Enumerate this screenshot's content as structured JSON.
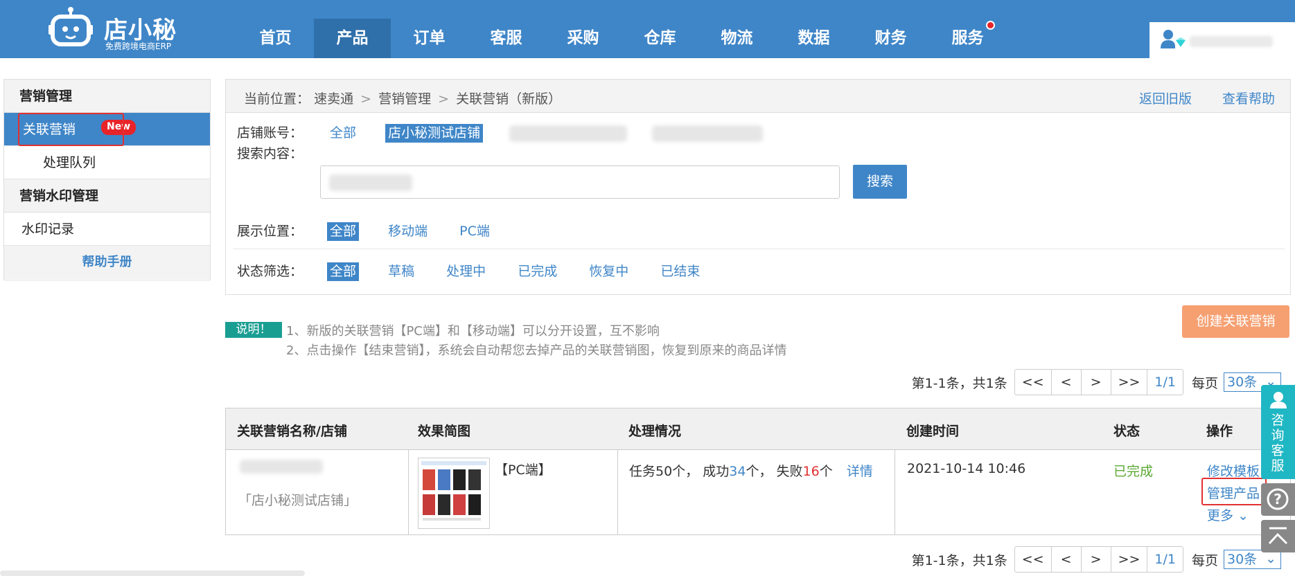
{
  "header": {
    "logo_brand": "店小秘",
    "logo_slogan": "免费跨境电商ERP",
    "nav": [
      {
        "label": "首页"
      },
      {
        "label": "产品",
        "active": true
      },
      {
        "label": "订单"
      },
      {
        "label": "客服"
      },
      {
        "label": "采购"
      },
      {
        "label": "仓库"
      },
      {
        "label": "物流"
      },
      {
        "label": "数据"
      },
      {
        "label": "财务"
      },
      {
        "label": "服务",
        "dot": true
      }
    ],
    "user_icon": "user-diamond-icon",
    "brand_color": "#3f86c8"
  },
  "sidebar": {
    "section1": "营销管理",
    "item_active": "关联营销",
    "new_badge": "New",
    "item_sub": "处理队列",
    "section2": "营销水印管理",
    "item_watermark": "水印记录",
    "help": "帮助手册"
  },
  "breadcrumb": {
    "prefix": "当前位置：",
    "parts": [
      "速卖通",
      "营销管理",
      "关联营销（新版）"
    ],
    "back_old": "返回旧版",
    "help": "查看帮助"
  },
  "filters": {
    "shop_label": "店铺账号：",
    "shop_all": "全部",
    "shop_selected": "店小秘测试店铺",
    "search_label": "搜索内容：",
    "search_button": "搜索",
    "position_label": "展示位置：",
    "positions": [
      "全部",
      "移动端",
      "PC端"
    ],
    "status_label": "状态筛选：",
    "statuses": [
      "全部",
      "草稿",
      "处理中",
      "已完成",
      "恢复中",
      "已结束"
    ]
  },
  "notes": {
    "tag": "说明！",
    "line1": "1、新版的关联营销【PC端】和【移动端】可以分开设置，互不影响",
    "line2": "2、点击操作【结束营销】，系统会自动帮您去掉产品的关联营销图，恢复到原来的商品详情",
    "create_button": "创建关联营销",
    "create_color": "#f6a072"
  },
  "pager": {
    "summary": "第1-1条，共1条",
    "first": "<<",
    "prev": "<",
    "next": ">",
    "last": ">>",
    "current": "1/1",
    "per_page_label": "每页",
    "per_page_value": "30条"
  },
  "table": {
    "headers": [
      "关联营销名称/店铺",
      "效果简图",
      "处理情况",
      "创建时间",
      "状态",
      "操作"
    ],
    "row": {
      "shop": "「店小秘测试店铺」",
      "platform": "【PC端】",
      "task_prefix": "任务50个，",
      "success_label": "成功",
      "success_count": "34",
      "success_unit": "个，",
      "fail_label": "失败",
      "fail_count": "16",
      "fail_unit": "个",
      "detail_link": "详情",
      "created": "2021-10-14 10:46",
      "status": "已完成",
      "status_color": "#5aa832",
      "action_edit": "修改模板",
      "action_manage": "管理产品",
      "action_more": "更多"
    }
  },
  "float": {
    "consult": "咨询客服",
    "help_icon": "question-icon",
    "top_icon": "back-to-top-icon"
  }
}
